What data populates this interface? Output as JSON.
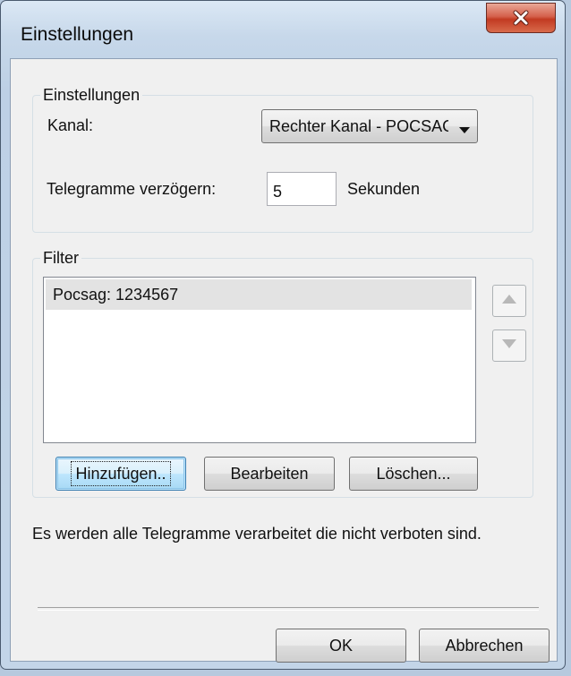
{
  "window": {
    "title": "Einstellungen"
  },
  "settings_group": {
    "title": "Einstellungen",
    "channel_label": "Kanal:",
    "channel_value": "Rechter Kanal - POCSAG",
    "delay_label": "Telegramme verzögern:",
    "delay_value": "5",
    "delay_unit": "Sekunden"
  },
  "filter_group": {
    "title": "Filter",
    "items": [
      "Pocsag: 1234567"
    ],
    "add_label": "Hinzufügen..",
    "edit_label": "Bearbeiten",
    "delete_label": "Löschen..."
  },
  "info_text": "Es werden alle Telegramme verarbeitet die nicht verboten sind.",
  "buttons": {
    "ok_label": "OK",
    "cancel_label": "Abbrechen"
  },
  "icons": {
    "close": "close-icon",
    "dropdown": "chevron-down-icon",
    "up": "arrow-up-icon",
    "down": "arrow-down-icon"
  }
}
